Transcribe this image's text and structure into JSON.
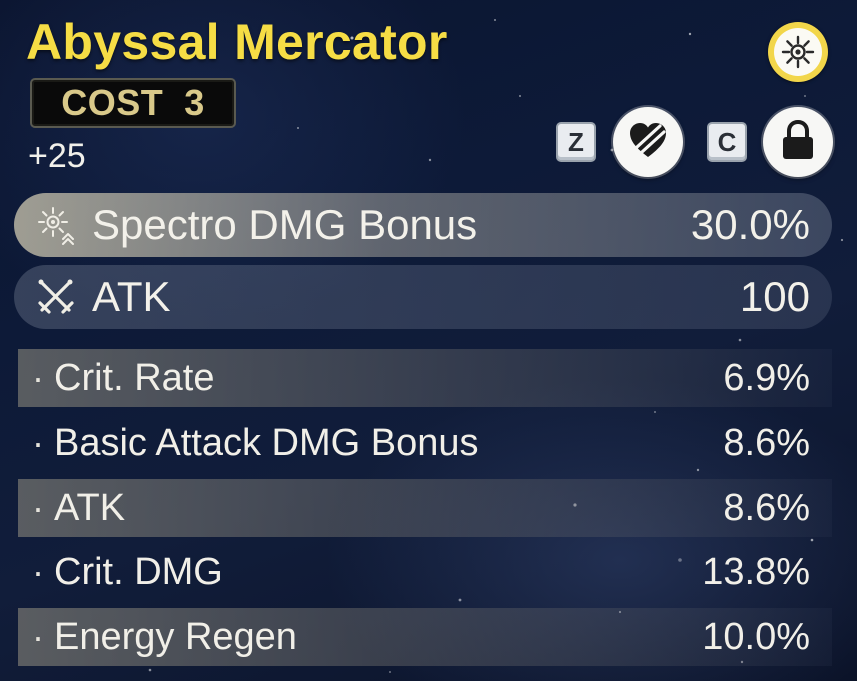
{
  "echo": {
    "name": "Abyssal Mercator",
    "cost_label": "COST  3",
    "level": "+25"
  },
  "icons": {
    "sonata": "sonata-set-icon",
    "lock_key": "Z",
    "discard_key": "C",
    "lock_button": "heart-lock-icon",
    "discard_button": "padlock-icon"
  },
  "main_stats": [
    {
      "icon": "spectro-icon",
      "name": "Spectro DMG Bonus",
      "value": "30.0%"
    },
    {
      "icon": "atk-icon",
      "name": "ATK",
      "value": "100"
    }
  ],
  "sub_stats": [
    {
      "name": "Crit. Rate",
      "value": "6.9%"
    },
    {
      "name": "Basic Attack DMG Bonus",
      "value": "8.6%"
    },
    {
      "name": "ATK",
      "value": "8.6%"
    },
    {
      "name": "Crit. DMG",
      "value": "13.8%"
    },
    {
      "name": "Energy Regen",
      "value": "10.0%"
    }
  ],
  "colors": {
    "title": "#f6dd45",
    "cost_text": "#d9c98a",
    "text": "#f3f1ea",
    "background": "#0d1a38",
    "sonata_ring": "#f2d64a"
  }
}
